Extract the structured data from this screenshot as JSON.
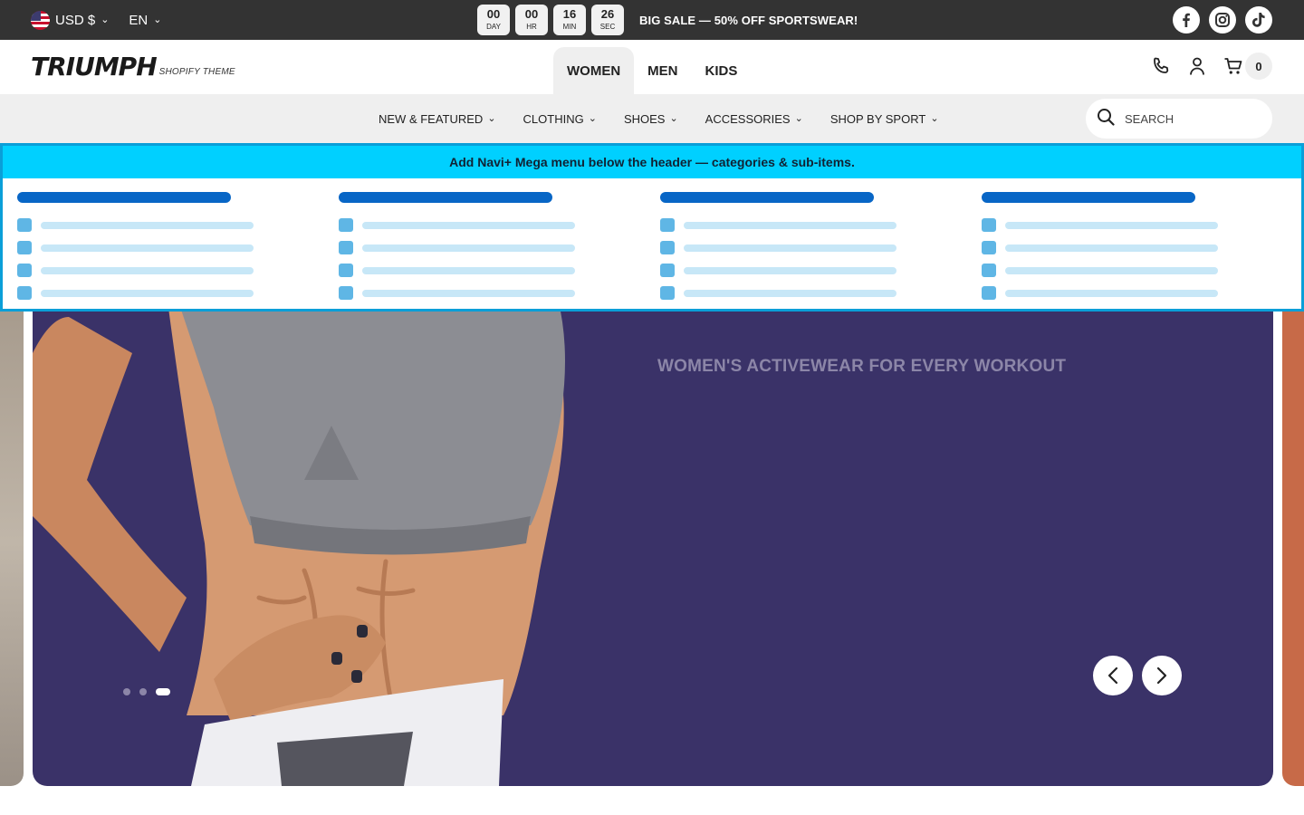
{
  "topbar": {
    "currency": "USD $",
    "language": "EN",
    "countdown": [
      {
        "value": "00",
        "unit": "DAY"
      },
      {
        "value": "00",
        "unit": "HR"
      },
      {
        "value": "16",
        "unit": "MIN"
      },
      {
        "value": "26",
        "unit": "SEC"
      }
    ],
    "sale_text": "BIG SALE — 50% OFF SPORTSWEAR!",
    "social": [
      "facebook-icon",
      "instagram-icon",
      "tiktok-icon"
    ]
  },
  "header": {
    "logo": "TRIUMPH",
    "logo_sub": "SHOPIFY THEME",
    "tabs": [
      "WOMEN",
      "MEN",
      "KIDS"
    ],
    "active_tab": "WOMEN",
    "cart_count": "0"
  },
  "subnav": {
    "items": [
      "NEW & FEATURED",
      "CLOTHING",
      "SHOES",
      "ACCESSORIES",
      "SHOP BY SPORT"
    ],
    "search_placeholder": "SEARCH"
  },
  "mega": {
    "banner": "Add Navi+ Mega menu below the header — categories & sub-items."
  },
  "hero": {
    "heading": "WOMEN'S ACTIVEWEAR FOR EVERY WORKOUT",
    "slide_count": 3,
    "active_slide": 3
  },
  "colors": {
    "topbar_bg": "#333333",
    "hero_bg": "#3a3268",
    "mega_banner": "#00d0ff",
    "mega_border": "#0a9fd8"
  }
}
